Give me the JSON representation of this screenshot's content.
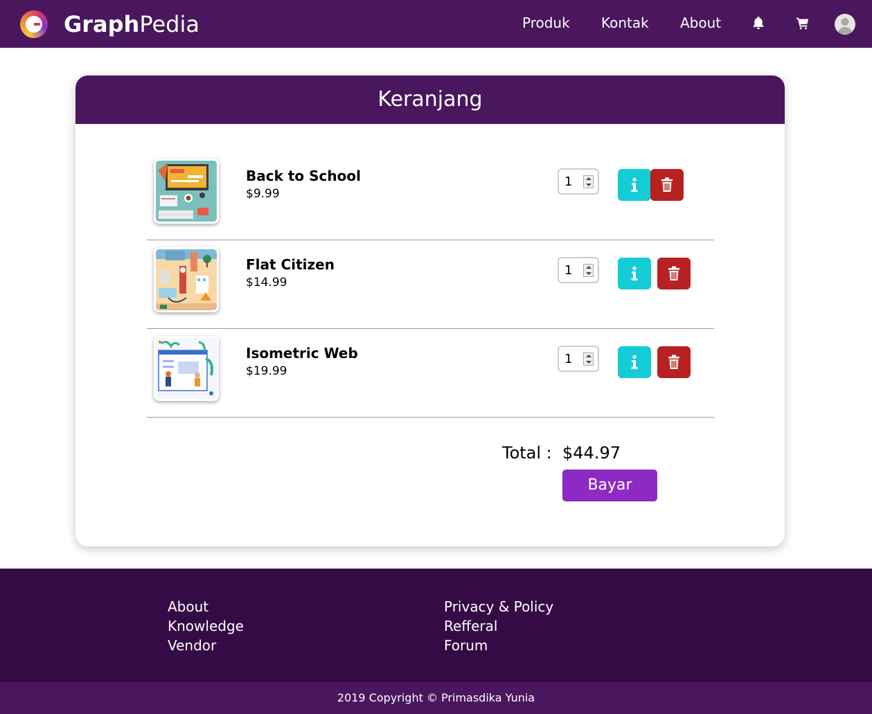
{
  "navbar": {
    "brand_bold": "Graph",
    "brand_rest": "Pedia",
    "links": [
      "Produk",
      "Kontak",
      "About"
    ],
    "icons": [
      "bell-icon",
      "cart-icon",
      "avatar-icon"
    ],
    "color": "#4a165e"
  },
  "cart": {
    "title": "Keranjang",
    "items": [
      {
        "name": "Back to School",
        "price": "$9.99",
        "qty": "1",
        "image": "desk-illustration"
      },
      {
        "name": "Flat Citizen",
        "price": "$14.99",
        "qty": "1",
        "image": "city-illustration"
      },
      {
        "name": "Isometric Web",
        "price": "$19.99",
        "qty": "1",
        "image": "web-illustration"
      }
    ],
    "total_label": "Total :",
    "total_value": "$44.97",
    "pay_label": "Bayar",
    "colors": {
      "info": "#14ccd6",
      "delete": "#b82121",
      "pay": "#8b2bc4"
    }
  },
  "footer": {
    "col1": [
      "About",
      "Knowledge",
      "Vendor"
    ],
    "col2": [
      "Privacy & Policy",
      "Refferal",
      "Forum"
    ],
    "copyright": "2019 Copyright © Primasdika Yunia"
  }
}
